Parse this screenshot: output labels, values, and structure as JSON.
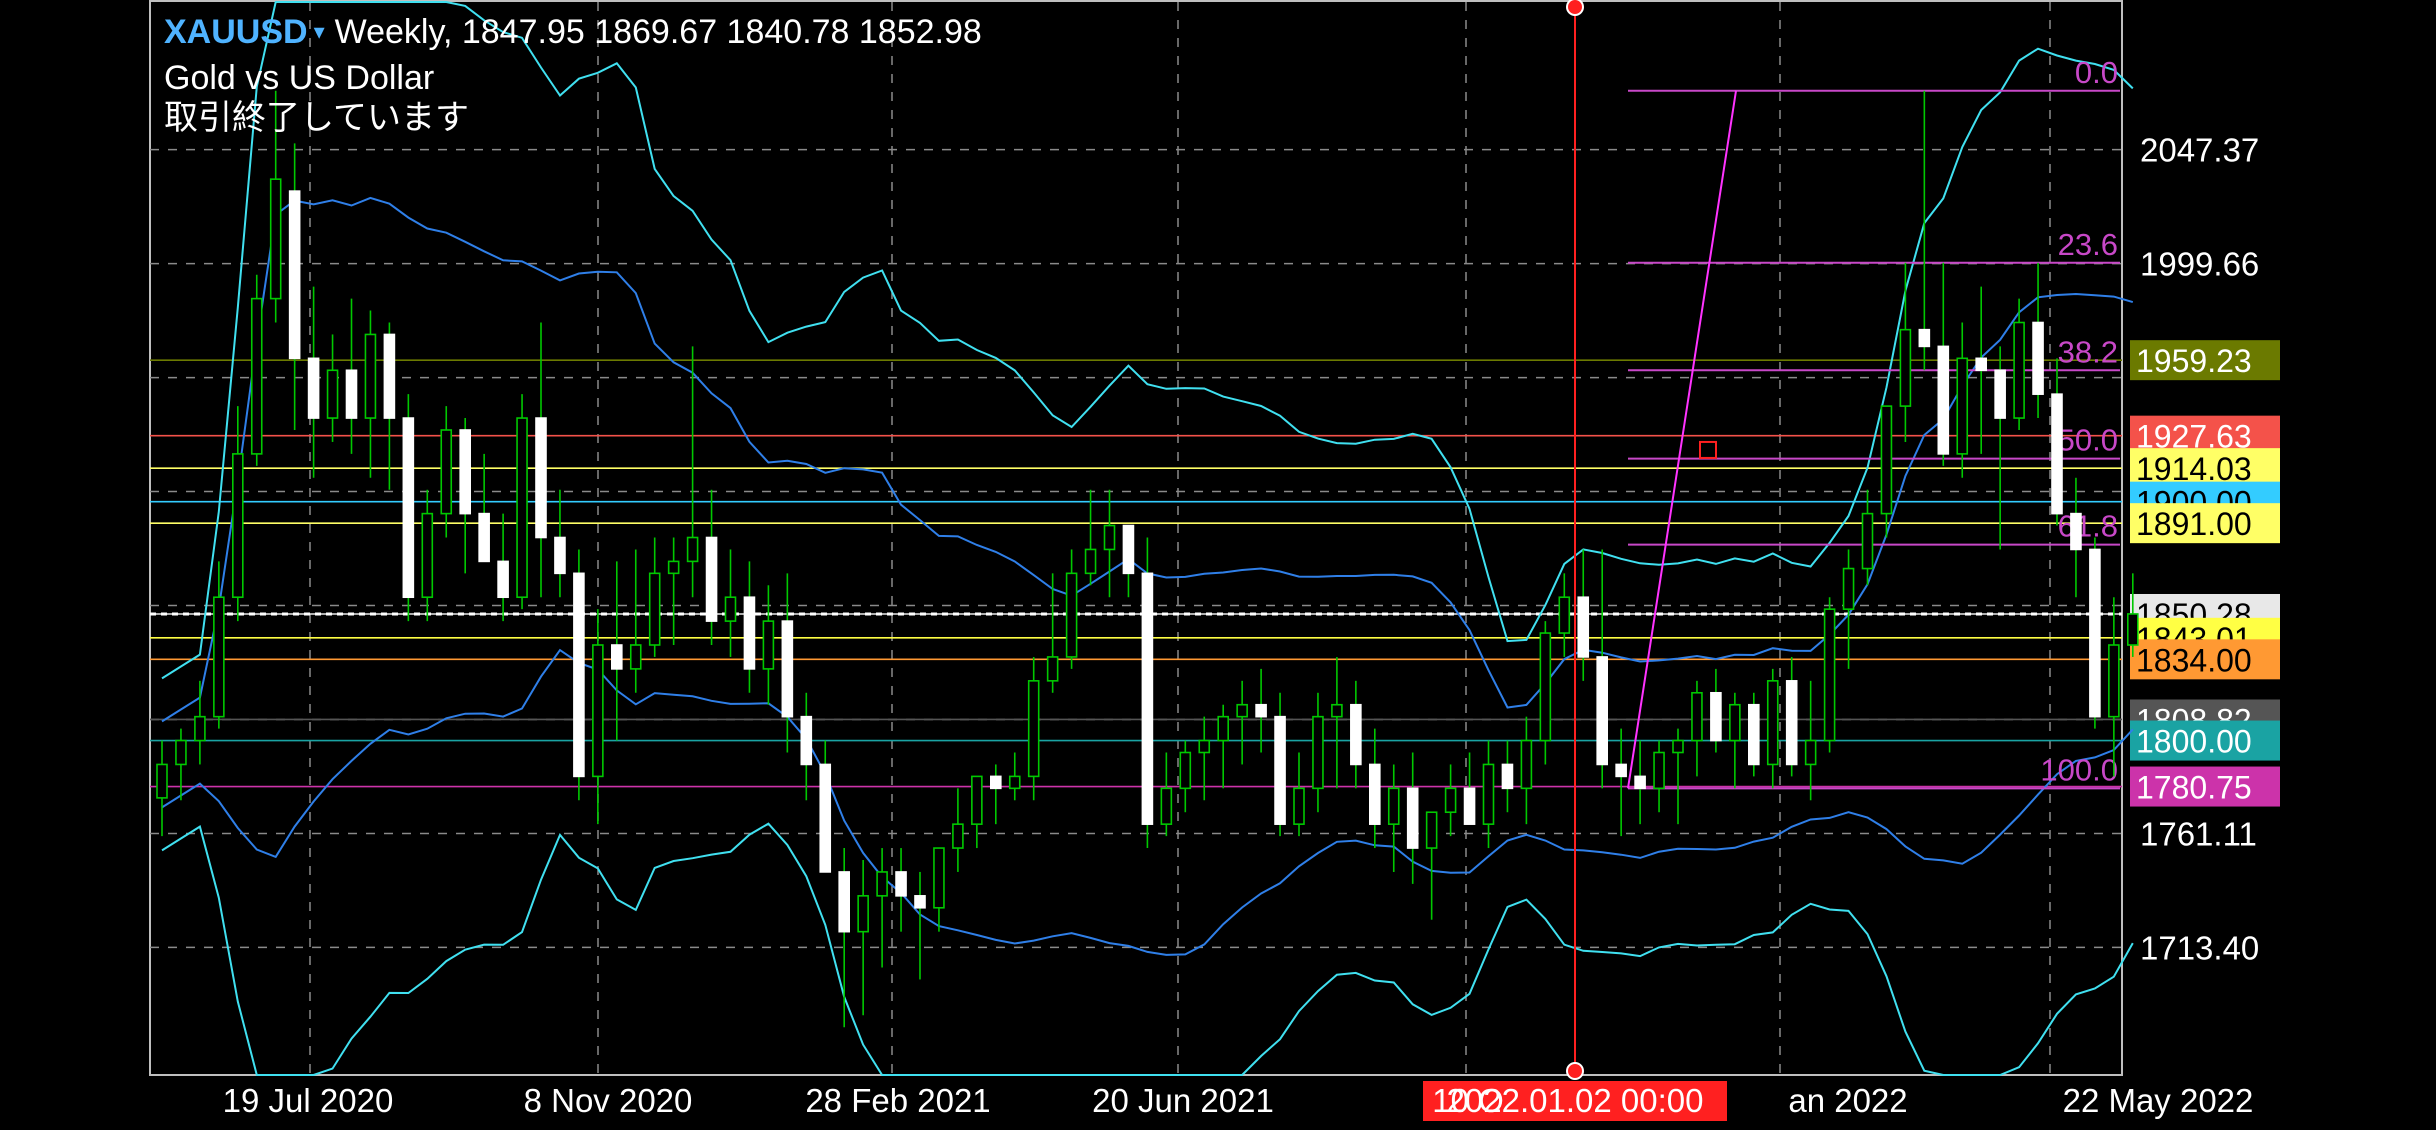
{
  "header": {
    "symbol": "XAUUSD",
    "arrow": "▾",
    "timeframe": "Weekly,",
    "ohlc": "1847.95 1869.67 1840.78 1852.98",
    "description": "Gold vs US Dollar",
    "status": "取引終了しています"
  },
  "colors": {
    "background": "#000000",
    "up_candle": "#00c800",
    "down_candle_body": "#ffffff",
    "band_outer": "#40e0f0",
    "band_inner": "#2f7fe8",
    "fibo": "#c848c8",
    "crosshair": "#ff2020"
  },
  "crosshair_label": "2022.01.02 00:00",
  "chart_data": {
    "type": "candlestick",
    "interval": "weekly",
    "symbol": "XAUUSD",
    "ylim": [
      1660,
      2110
    ],
    "time_axis_labels": [
      "19 Jul 2020",
      "8 Nov 2020",
      "28 Feb 2021",
      "20 Jun 2021",
      "10 O",
      "an 2022",
      "22 May 2022"
    ],
    "price_axis_labels": [
      "2047.37",
      "1999.66",
      "1761.11",
      "1713.40"
    ],
    "price_axis_label_values": [
      2047.37,
      1999.66,
      1761.11,
      1713.4
    ],
    "fibonacci_levels": [
      {
        "label": "0.0",
        "price": 2072
      },
      {
        "label": "23.6",
        "price": 2000
      },
      {
        "label": "38.2",
        "price": 1955
      },
      {
        "label": "50.0",
        "price": 1918
      },
      {
        "label": "61.8",
        "price": 1882
      },
      {
        "label": "100.0",
        "price": 1780
      }
    ],
    "horizontal_levels": [
      {
        "label": "1959.23",
        "price": 1959.23,
        "color": "#6b7a00",
        "text_color": "#ffffff"
      },
      {
        "label": "1927.63",
        "price": 1927.63,
        "color": "#f4524a",
        "text_color": "#ffffff"
      },
      {
        "label": "1914.03",
        "price": 1914.03,
        "color": "#ffff66",
        "text_color": "#000000"
      },
      {
        "label": "1900.00",
        "price": 1900.0,
        "color": "#33ccff",
        "text_color": "#000000"
      },
      {
        "label": "1891.00",
        "price": 1891.0,
        "color": "#ffff66",
        "text_color": "#000000"
      },
      {
        "label": "1850.28",
        "price": 1852.98,
        "color": "#e8e8e8",
        "text_color": "#000000"
      },
      {
        "label": "1843.01",
        "price": 1843.01,
        "color": "#ffff44",
        "text_color": "#000000"
      },
      {
        "label": "1834.00",
        "price": 1834.0,
        "color": "#ff9933",
        "text_color": "#000000"
      },
      {
        "label": "1808.82",
        "price": 1808.82,
        "color": "#555555",
        "text_color": "#ffffff"
      },
      {
        "label": "1800.00",
        "price": 1800.0,
        "color": "#1aa3a3",
        "text_color": "#ffffff"
      },
      {
        "label": "1780.75",
        "price": 1780.75,
        "color": "#cc33aa",
        "text_color": "#ffffff"
      }
    ],
    "candles": [
      [
        1776,
        1800,
        1760,
        1790
      ],
      [
        1790,
        1805,
        1775,
        1800
      ],
      [
        1800,
        1825,
        1790,
        1810
      ],
      [
        1810,
        1875,
        1805,
        1860
      ],
      [
        1860,
        1940,
        1850,
        1920
      ],
      [
        1920,
        1995,
        1915,
        1985
      ],
      [
        1985,
        2072,
        1975,
        2035
      ],
      [
        2030,
        2050,
        1930,
        1960
      ],
      [
        1960,
        1990,
        1910,
        1935
      ],
      [
        1935,
        1970,
        1925,
        1955
      ],
      [
        1955,
        1985,
        1920,
        1935
      ],
      [
        1935,
        1980,
        1910,
        1970
      ],
      [
        1970,
        1975,
        1905,
        1935
      ],
      [
        1935,
        1945,
        1850,
        1860
      ],
      [
        1860,
        1905,
        1850,
        1895
      ],
      [
        1895,
        1940,
        1885,
        1930
      ],
      [
        1930,
        1935,
        1870,
        1895
      ],
      [
        1895,
        1920,
        1875,
        1875
      ],
      [
        1875,
        1895,
        1850,
        1860
      ],
      [
        1860,
        1945,
        1855,
        1935
      ],
      [
        1935,
        1975,
        1860,
        1885
      ],
      [
        1885,
        1905,
        1860,
        1870
      ],
      [
        1870,
        1880,
        1775,
        1785
      ],
      [
        1785,
        1855,
        1765,
        1840
      ],
      [
        1840,
        1875,
        1800,
        1830
      ],
      [
        1830,
        1880,
        1820,
        1840
      ],
      [
        1840,
        1885,
        1835,
        1870
      ],
      [
        1870,
        1885,
        1840,
        1875
      ],
      [
        1875,
        1965,
        1860,
        1885
      ],
      [
        1885,
        1905,
        1840,
        1850
      ],
      [
        1850,
        1880,
        1835,
        1860
      ],
      [
        1860,
        1875,
        1820,
        1830
      ],
      [
        1830,
        1865,
        1815,
        1850
      ],
      [
        1850,
        1870,
        1795,
        1810
      ],
      [
        1810,
        1820,
        1775,
        1790
      ],
      [
        1790,
        1800,
        1745,
        1745
      ],
      [
        1745,
        1755,
        1680,
        1720
      ],
      [
        1720,
        1750,
        1685,
        1735
      ],
      [
        1735,
        1755,
        1705,
        1745
      ],
      [
        1745,
        1755,
        1720,
        1735
      ],
      [
        1735,
        1745,
        1700,
        1730
      ],
      [
        1730,
        1755,
        1720,
        1755
      ],
      [
        1755,
        1780,
        1745,
        1765
      ],
      [
        1765,
        1785,
        1755,
        1785
      ],
      [
        1785,
        1790,
        1765,
        1780
      ],
      [
        1780,
        1795,
        1775,
        1785
      ],
      [
        1785,
        1835,
        1775,
        1825
      ],
      [
        1825,
        1870,
        1820,
        1835
      ],
      [
        1835,
        1880,
        1830,
        1870
      ],
      [
        1870,
        1905,
        1865,
        1880
      ],
      [
        1880,
        1905,
        1860,
        1890
      ],
      [
        1890,
        1890,
        1860,
        1870
      ],
      [
        1870,
        1885,
        1755,
        1765
      ],
      [
        1765,
        1795,
        1760,
        1780
      ],
      [
        1780,
        1800,
        1770,
        1795
      ],
      [
        1795,
        1810,
        1775,
        1800
      ],
      [
        1800,
        1815,
        1780,
        1810
      ],
      [
        1810,
        1825,
        1790,
        1815
      ],
      [
        1815,
        1830,
        1795,
        1810
      ],
      [
        1810,
        1820,
        1760,
        1765
      ],
      [
        1765,
        1795,
        1760,
        1780
      ],
      [
        1780,
        1820,
        1770,
        1810
      ],
      [
        1810,
        1835,
        1780,
        1815
      ],
      [
        1815,
        1825,
        1780,
        1790
      ],
      [
        1790,
        1805,
        1755,
        1765
      ],
      [
        1765,
        1790,
        1745,
        1780
      ],
      [
        1780,
        1795,
        1740,
        1755
      ],
      [
        1755,
        1770,
        1725,
        1770
      ],
      [
        1770,
        1790,
        1760,
        1780
      ],
      [
        1780,
        1795,
        1765,
        1765
      ],
      [
        1765,
        1800,
        1755,
        1790
      ],
      [
        1790,
        1800,
        1770,
        1780
      ],
      [
        1780,
        1810,
        1765,
        1800
      ],
      [
        1800,
        1850,
        1790,
        1845
      ],
      [
        1845,
        1870,
        1835,
        1860
      ],
      [
        1860,
        1880,
        1825,
        1835
      ],
      [
        1835,
        1880,
        1780,
        1790
      ],
      [
        1790,
        1805,
        1760,
        1785
      ],
      [
        1785,
        1800,
        1765,
        1780
      ],
      [
        1780,
        1800,
        1770,
        1795
      ],
      [
        1795,
        1805,
        1765,
        1800
      ],
      [
        1800,
        1825,
        1785,
        1820
      ],
      [
        1820,
        1830,
        1795,
        1800
      ],
      [
        1800,
        1820,
        1780,
        1815
      ],
      [
        1815,
        1820,
        1785,
        1790
      ],
      [
        1790,
        1830,
        1780,
        1825
      ],
      [
        1825,
        1835,
        1785,
        1790
      ],
      [
        1790,
        1825,
        1775,
        1800
      ],
      [
        1800,
        1860,
        1795,
        1855
      ],
      [
        1855,
        1880,
        1830,
        1872
      ],
      [
        1872,
        1905,
        1865,
        1895
      ],
      [
        1895,
        1935,
        1885,
        1940
      ],
      [
        1940,
        2000,
        1925,
        1972
      ],
      [
        1972,
        2072,
        1955,
        1965
      ],
      [
        1965,
        2000,
        1915,
        1920
      ],
      [
        1920,
        1975,
        1910,
        1960
      ],
      [
        1960,
        1990,
        1920,
        1955
      ],
      [
        1955,
        1965,
        1880,
        1935
      ],
      [
        1935,
        1985,
        1930,
        1975
      ],
      [
        1975,
        2000,
        1935,
        1945
      ],
      [
        1945,
        1960,
        1890,
        1895
      ],
      [
        1895,
        1910,
        1860,
        1880
      ],
      [
        1880,
        1885,
        1805,
        1810
      ],
      [
        1810,
        1860,
        1785,
        1840
      ],
      [
        1840,
        1870,
        1835,
        1853
      ]
    ]
  }
}
